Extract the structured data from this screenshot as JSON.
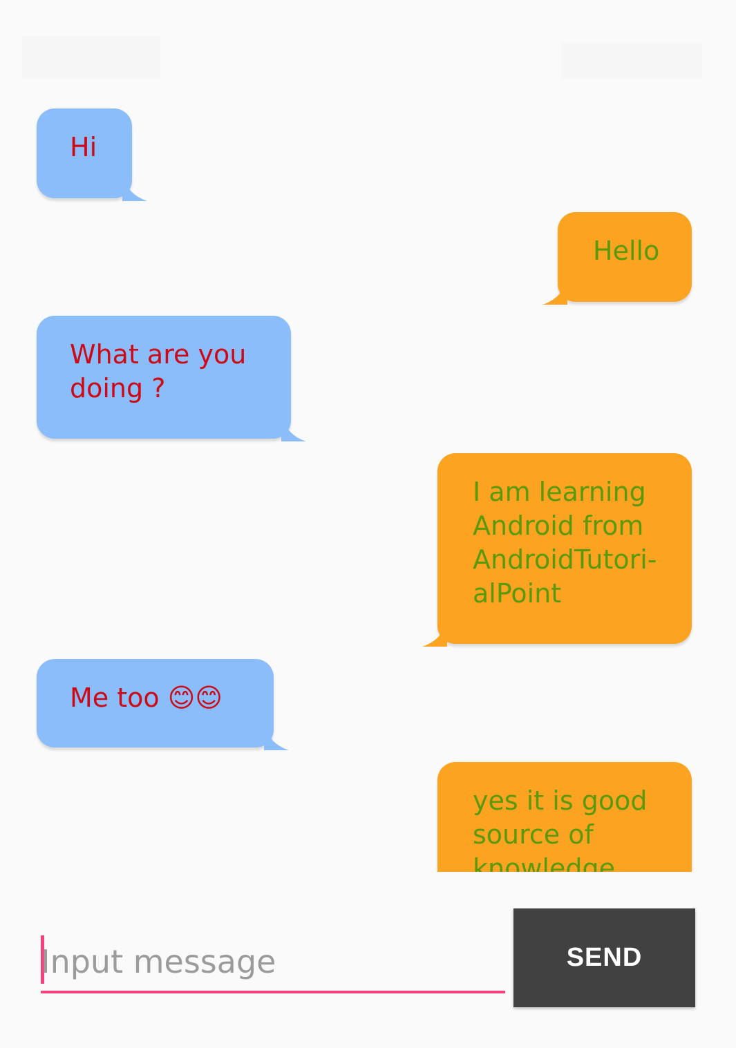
{
  "chat": {
    "messages": [
      {
        "side": "received",
        "text": "Hi"
      },
      {
        "side": "sent",
        "text": "Hello"
      },
      {
        "side": "received",
        "text": "What are you\ndoing ?"
      },
      {
        "side": "sent",
        "text": "I am learning\nAndroid from\nAndroidTutori-\nalPoint"
      },
      {
        "side": "received",
        "text": "Me too 😊😊"
      },
      {
        "side": "sent",
        "text": "yes it is good\nsource of\nknowledge"
      }
    ]
  },
  "composer": {
    "placeholder": "Input message",
    "value": "",
    "send_label": "SEND"
  },
  "colors": {
    "received_bubble": "#8bbdfa",
    "received_text": "#cc0a17",
    "sent_bubble": "#fca322",
    "sent_text": "#5a9a0a",
    "accent": "#f2427d",
    "send_button": "#414141"
  }
}
